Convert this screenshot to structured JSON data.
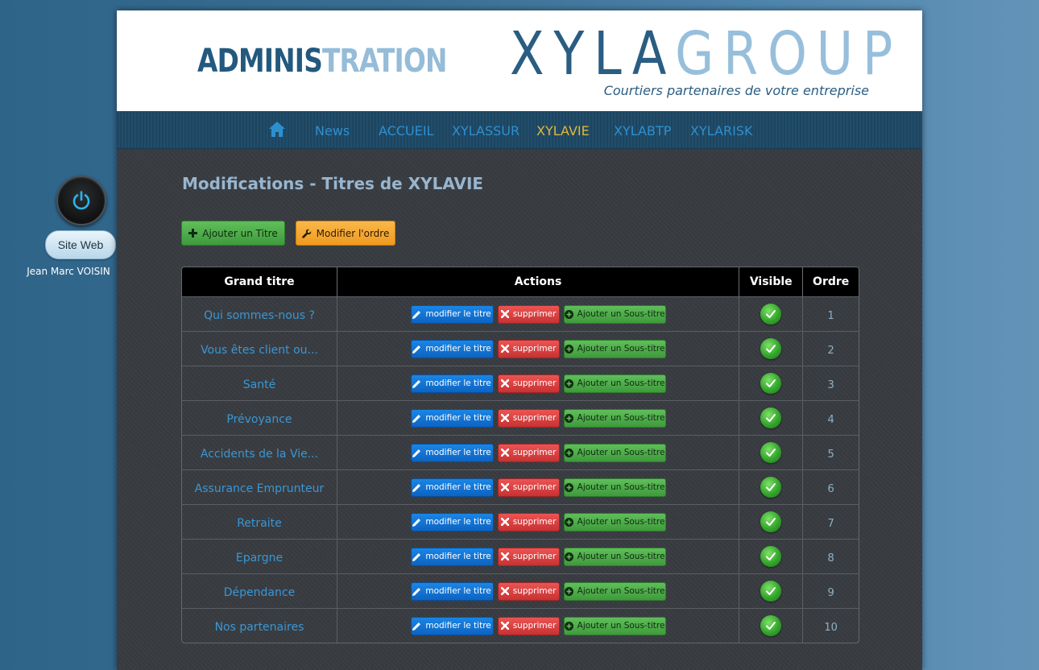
{
  "sidebar": {
    "site_web_label": "Site Web",
    "user_name": "Jean Marc VOISIN"
  },
  "header": {
    "admin_part1": "ADMINIS",
    "admin_part2": "TRATION",
    "logo_part1": "XYLA",
    "logo_part2": "GROUP",
    "tagline": "Courtiers partenaires de votre entreprise"
  },
  "nav": {
    "items": [
      {
        "label": "News"
      },
      {
        "label": "ACCUEIL"
      },
      {
        "label": "XYLASSUR"
      },
      {
        "label": "XYLAVIE"
      },
      {
        "label": "XYLABTP"
      },
      {
        "label": "XYLARISK"
      }
    ],
    "active": "XYLAVIE"
  },
  "main": {
    "page_title": "Modifications - Titres de XYLAVIE",
    "add_button_label": "Ajouter un Titre",
    "order_button_label": "Modifier l'ordre"
  },
  "table": {
    "headers": [
      "Grand titre",
      "Actions",
      "Visible",
      "Ordre"
    ],
    "action_labels": {
      "edit": "modifier le titre",
      "delete": "supprimer",
      "add_sub": "Ajouter un Sous-titre"
    },
    "rows": [
      {
        "title": "Qui sommes-nous ?",
        "order": "1",
        "visible": true
      },
      {
        "title": "Vous êtes client ou...",
        "order": "2",
        "visible": true
      },
      {
        "title": "Santé",
        "order": "3",
        "visible": true
      },
      {
        "title": "Prévoyance",
        "order": "4",
        "visible": true
      },
      {
        "title": "Accidents de la Vie...",
        "order": "5",
        "visible": true
      },
      {
        "title": "Assurance Emprunteur",
        "order": "6",
        "visible": true
      },
      {
        "title": "Retraite",
        "order": "7",
        "visible": true
      },
      {
        "title": "Epargne",
        "order": "8",
        "visible": true
      },
      {
        "title": "Dépendance",
        "order": "9",
        "visible": true
      },
      {
        "title": "Nos partenaires",
        "order": "10",
        "visible": true
      }
    ]
  },
  "colors": {
    "accent_blue": "#2e8fd0",
    "active_nav": "#e0b838",
    "brand_dark": "#23597e",
    "brand_light": "#95bcd8"
  }
}
